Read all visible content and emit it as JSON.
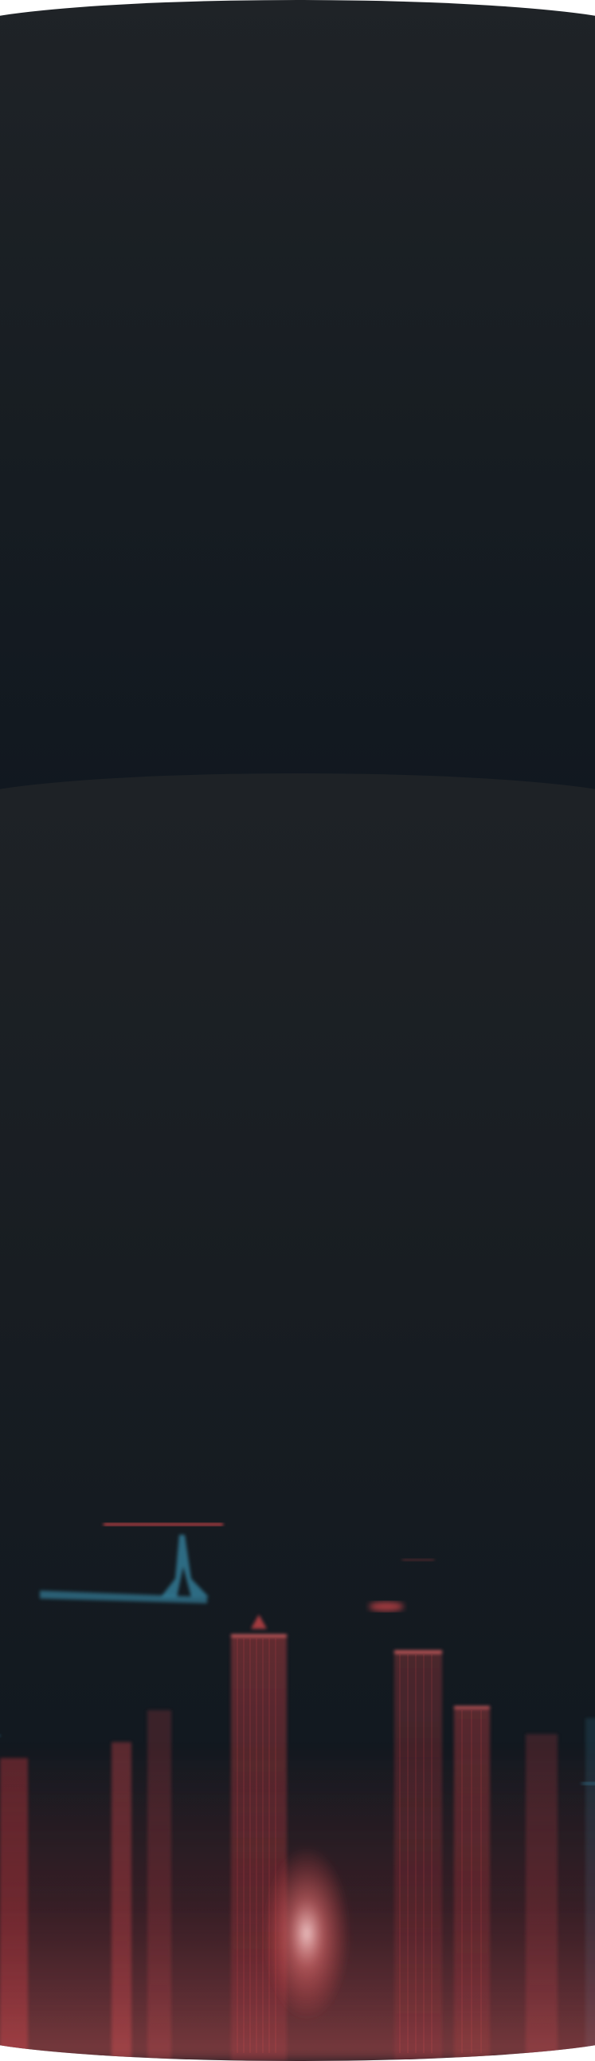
{
  "background": {
    "page_color": "#ffffff",
    "panel_top_color": "#1c2126",
    "panel_bottom_color": "#131a20"
  },
  "decoration": {
    "image": "city-skyline-night",
    "accent_colors": [
      "#e0484d",
      "#3fa3c6"
    ]
  }
}
